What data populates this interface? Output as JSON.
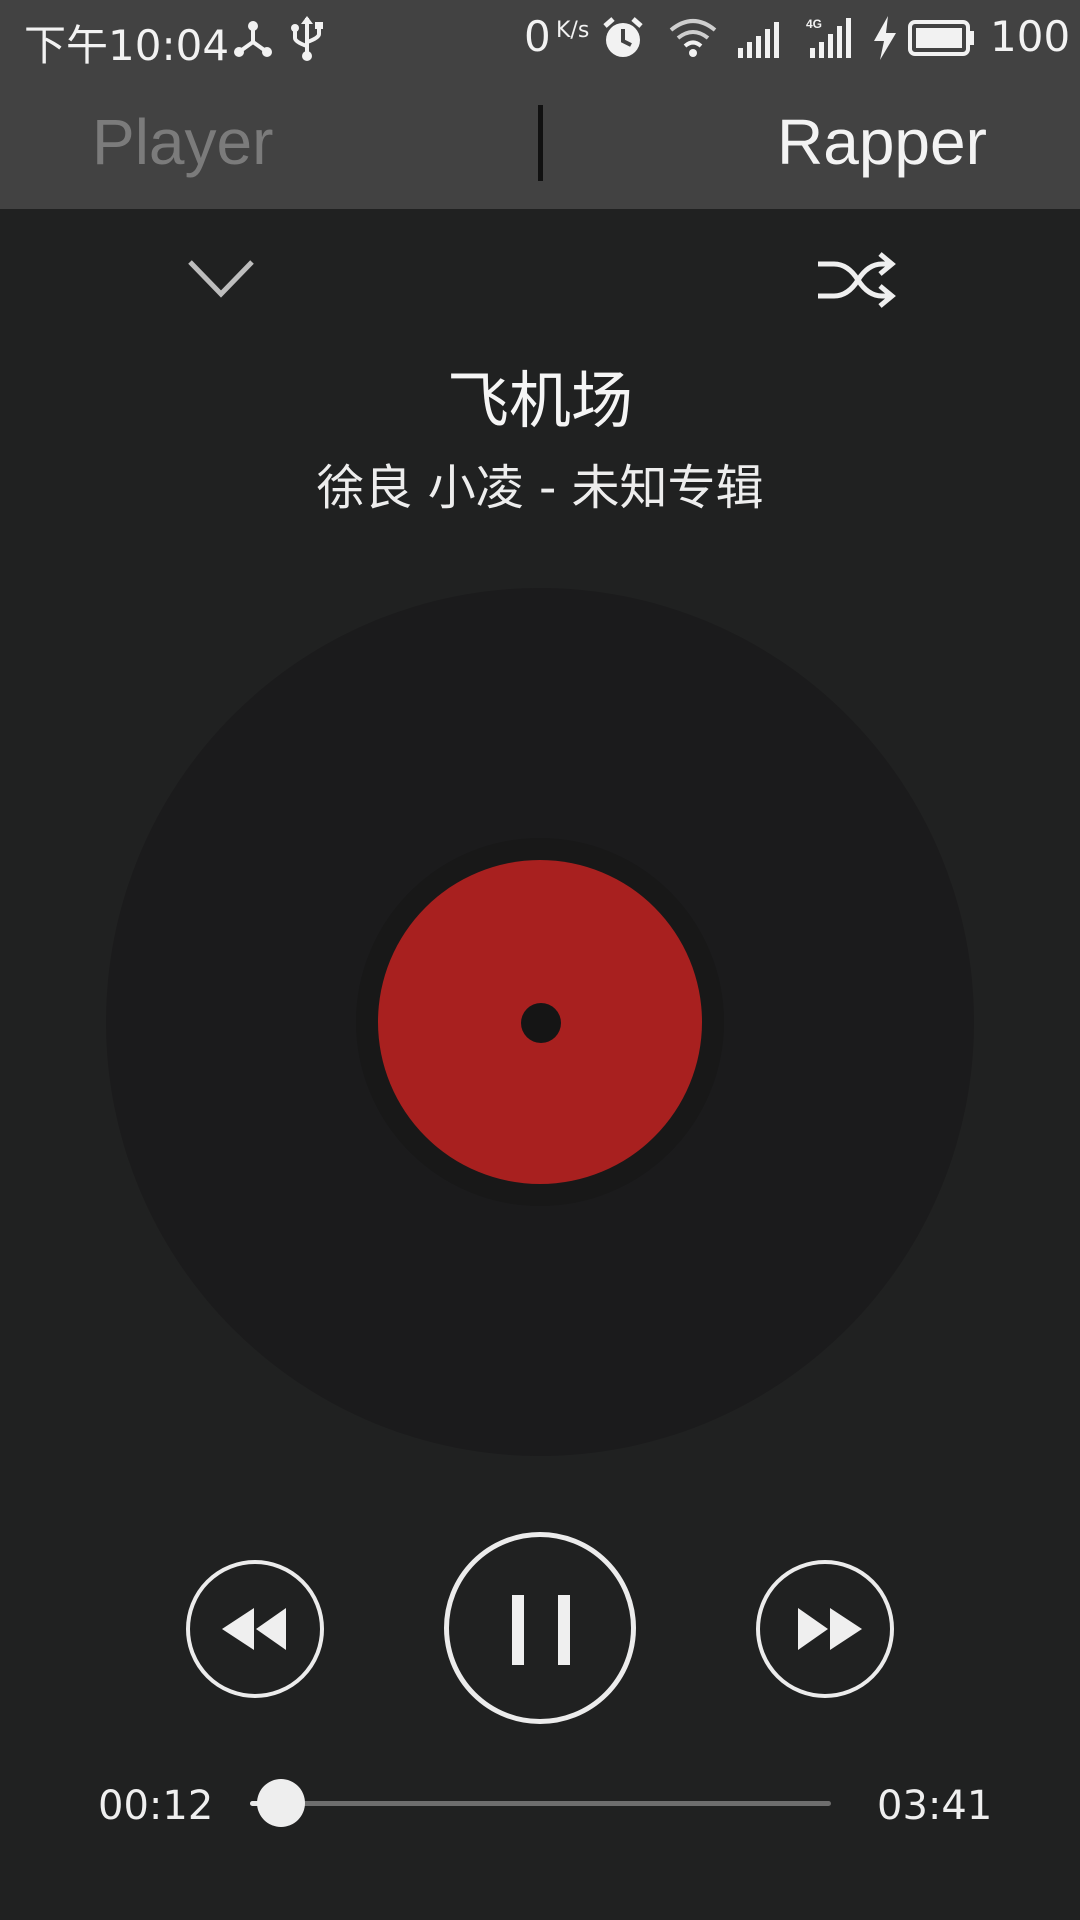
{
  "status_bar": {
    "time": "下午10:04",
    "net_speed_value": "0",
    "net_speed_unit": "K/s",
    "battery_level": "100",
    "icons": [
      "share-hub-icon",
      "usb-icon",
      "alarm-icon",
      "wifi-icon",
      "signal-icon",
      "4g-signal-icon",
      "charging-icon",
      "battery-icon"
    ]
  },
  "tabs": {
    "player": "Player",
    "rapper": "Rapper",
    "active": "Rapper"
  },
  "header": {
    "collapse_icon": "chevron-down-icon",
    "shuffle_icon": "shuffle-icon"
  },
  "song": {
    "title": "飞机场",
    "subtitle": "徐良 小凌 - 未知专辑"
  },
  "record": {
    "label_color": "#a8201f"
  },
  "controls": {
    "prev_icon": "rewind-icon",
    "play_pause_icon": "pause-icon",
    "next_icon": "fast-forward-icon"
  },
  "progress": {
    "current": "00:12",
    "total": "03:41",
    "fraction": 0.054
  },
  "colors": {
    "background": "#202121",
    "bar": "#424242",
    "accent": "#eeeeee"
  }
}
